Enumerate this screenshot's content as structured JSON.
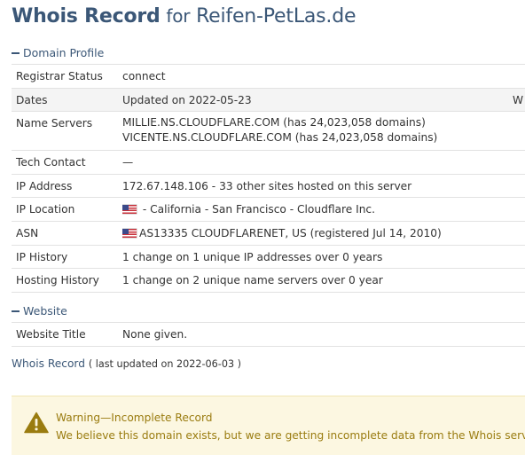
{
  "header": {
    "title_main": "Whois Record",
    "title_for": "for",
    "domain": "Reifen-PetLas.de"
  },
  "domain_profile": {
    "heading": "Domain Profile",
    "rows": [
      {
        "label": "Registrar Status",
        "value": "connect"
      },
      {
        "label": "Dates",
        "value": "Updated on 2022-05-23",
        "extra": "W"
      },
      {
        "label": "Name Servers",
        "value": "MILLIE.NS.CLOUDFLARE.COM (has 24,023,058 domains)",
        "value2": "VICENTE.NS.CLOUDFLARE.COM (has 24,023,058 domains)"
      },
      {
        "label": "Tech Contact",
        "value": "—"
      },
      {
        "label": "IP Address",
        "value": "172.67.148.106 - 33 other sites hosted on this server"
      },
      {
        "label": "IP Location",
        "value": " - California - San Francisco - Cloudflare Inc.",
        "flag": "us-flag-icon"
      },
      {
        "label": "ASN",
        "value": "AS13335 CLOUDFLARENET, US (registered Jul 14, 2010)",
        "flag": "us-flag-icon"
      },
      {
        "label": "IP History",
        "value": "1 change on 1 unique IP addresses over 0 years"
      },
      {
        "label": "Hosting History",
        "value": "1 change on 2 unique name servers over 0 year"
      }
    ]
  },
  "website": {
    "heading": "Website",
    "rows": [
      {
        "label": "Website Title",
        "value": "None given."
      }
    ]
  },
  "whois_footer": {
    "link": "Whois Record",
    "updated": "( last updated on 2022-06-03 )"
  },
  "warning": {
    "icon": "warning-triangle-icon",
    "title": "Warning—Incomplete Record",
    "text": "We believe this domain exists, but we are getting incomplete data from the Whois server."
  },
  "colors": {
    "accent": "#3b5777",
    "warning_text": "#9a7c10",
    "warning_bg": "#fcf7e1"
  }
}
